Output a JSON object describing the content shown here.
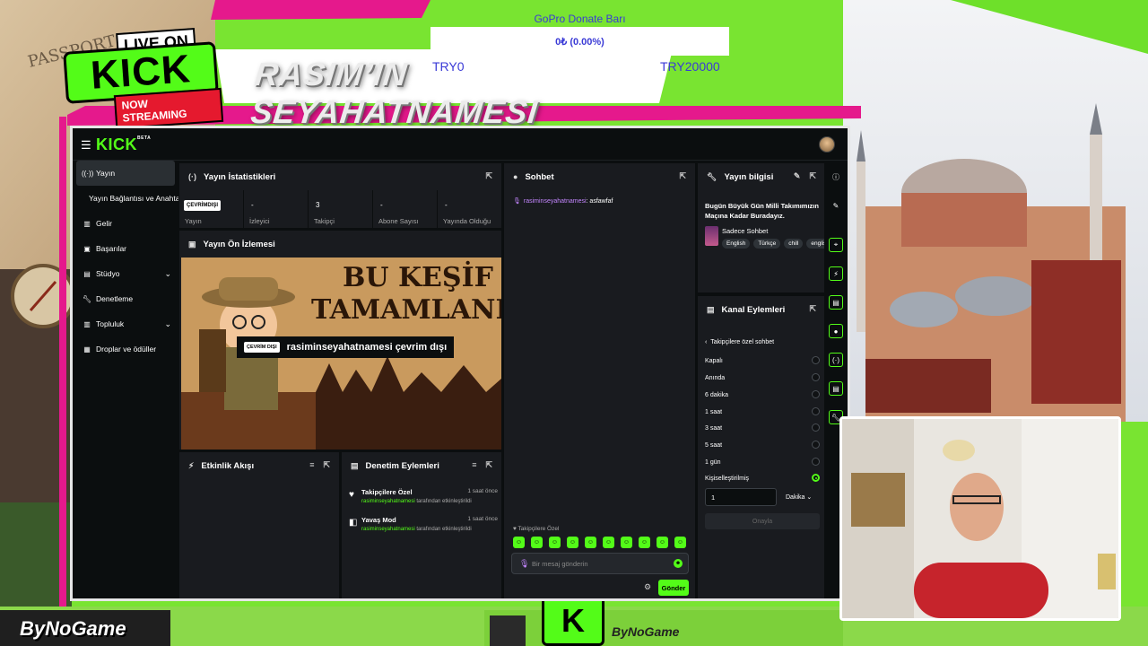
{
  "overlay": {
    "donate_title": "GoPro Donate Barı",
    "donate_value": "0₺ (0.00%)",
    "donate_min": "TRY0",
    "donate_max": "TRY20000",
    "show_title": "RASIM’IN SEYAHATNAMESI",
    "badge_live": "LIVE ON",
    "badge_kick": "KICK",
    "badge_now": "NOW STREAMING",
    "brand_left": "ByNoGame",
    "brand_center": "ByNoGame",
    "bottom_logo": "K",
    "passport": "PASSPORT",
    "accent_color": "#53fc18",
    "frame_color": "#e5198c"
  },
  "topbar": {
    "logo": "KICK",
    "logo_badge": "BETA"
  },
  "sidebar": {
    "items": [
      {
        "label": "Yayın",
        "icon": "broadcast-icon"
      },
      {
        "label": "Yayın Bağlantısı ve Anahtarı",
        "icon": ""
      },
      {
        "label": "Gelir",
        "icon": "chart-icon"
      },
      {
        "label": "Başarılar",
        "icon": "trophy-icon"
      },
      {
        "label": "Stüdyo",
        "icon": "studio-icon"
      },
      {
        "label": "Denetleme",
        "icon": "wrench-icon"
      },
      {
        "label": "Topluluk",
        "icon": "community-icon"
      },
      {
        "label": "Droplar ve ödüller",
        "icon": "gift-icon"
      }
    ]
  },
  "stats": {
    "title": "Yayın İstatistikleri",
    "cells": [
      {
        "value": "ÇEVRİMDIŞI",
        "label": "Yayın"
      },
      {
        "value": "-",
        "label": "İzleyici"
      },
      {
        "value": "3",
        "label": "Takipçi"
      },
      {
        "value": "-",
        "label": "Abone Sayısı"
      },
      {
        "value": "-",
        "label": "Yayında Olduğu"
      }
    ]
  },
  "preview": {
    "title": "Yayın Ön İzlemesi",
    "image_heading_1": "BU KEŞİF",
    "image_heading_2": "TAMAMLANDI",
    "offline_pill": "ÇEVRİM DIŞI",
    "offline_text": "rasiminseyahatnamesi çevrim dışı"
  },
  "activity": {
    "title": "Etkinlik Akışı"
  },
  "mod_actions": {
    "title": "Denetim Eylemleri",
    "items": [
      {
        "title": "Takipçilere Özel",
        "user": "rasiminseyahatnamesi",
        "suffix": " tarafından etkinleştirildi",
        "time": "1 saat önce"
      },
      {
        "title": "Yavaş Mod",
        "user": "rasiminseyahatnamesi",
        "suffix": " tarafından etkinleştirildi",
        "time": "1 saat önce"
      }
    ]
  },
  "chat": {
    "title": "Sohbet",
    "messages": [
      {
        "user": "rasiminseyahatnamesi",
        "text": ": asfawfaf"
      }
    ],
    "followers_only": "♥ Takipçilere Özel",
    "placeholder": "Bir mesaj gönderin",
    "send_label": "Gönder"
  },
  "stream_info": {
    "title": "Yayın bilgisi",
    "stream_title": "Bugün Büyük Gün Milli Takımımızın Maçına Kadar Buradayız.",
    "category": "Sadece Sohbet",
    "tags": [
      "English",
      "Türkçe",
      "chill",
      "english"
    ]
  },
  "channel_actions": {
    "title": "Kanal Eylemleri",
    "back_label": "Takipçilere özel sohbet",
    "options": [
      {
        "label": "Kapalı",
        "selected": false
      },
      {
        "label": "Anında",
        "selected": false
      },
      {
        "label": "6 dakika",
        "selected": false
      },
      {
        "label": "1 saat",
        "selected": false
      },
      {
        "label": "3 saat",
        "selected": false
      },
      {
        "label": "5 saat",
        "selected": false
      },
      {
        "label": "1 gün",
        "selected": false
      },
      {
        "label": "Kişiselleştirilmiş",
        "selected": true
      }
    ],
    "custom_value": "1",
    "unit": "Dakika",
    "confirm_label": "Onayla"
  }
}
